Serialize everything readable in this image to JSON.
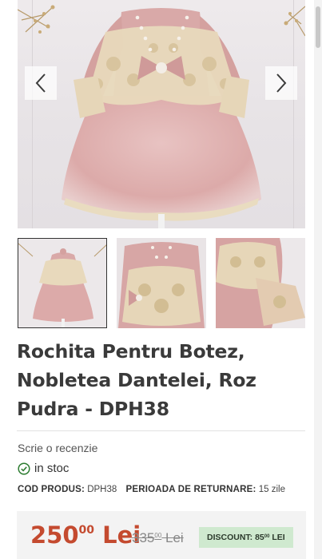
{
  "gallery": {
    "prev_icon": "chevron-left-icon",
    "next_icon": "chevron-right-icon",
    "thumbnail_count": 3,
    "active_thumbnail": 1
  },
  "product": {
    "title": "Rochita Pentru Botez, Nobletea Dantelei, Roz Pudra - DPH38",
    "review_link": "Scrie o recenzie",
    "stock_status": "in stoc",
    "code_label": "COD PRODUS:",
    "code_value": "DPH38",
    "return_label": "PERIOADA DE RETURNARE:",
    "return_value": "15 zile"
  },
  "price": {
    "current_main": "250",
    "current_cents": "00",
    "current_currency": "Lei",
    "old_main": "335",
    "old_cents": "00",
    "old_currency": "Lei",
    "discount_label": "DISCOUNT:",
    "discount_main": "85",
    "discount_cents": "00",
    "discount_currency": "LEI"
  },
  "colors": {
    "price": "#c44a2f",
    "discount_bg": "#cfe9cf",
    "dress_pink": "#e3b7b6",
    "lace": "#e9dcc0"
  }
}
